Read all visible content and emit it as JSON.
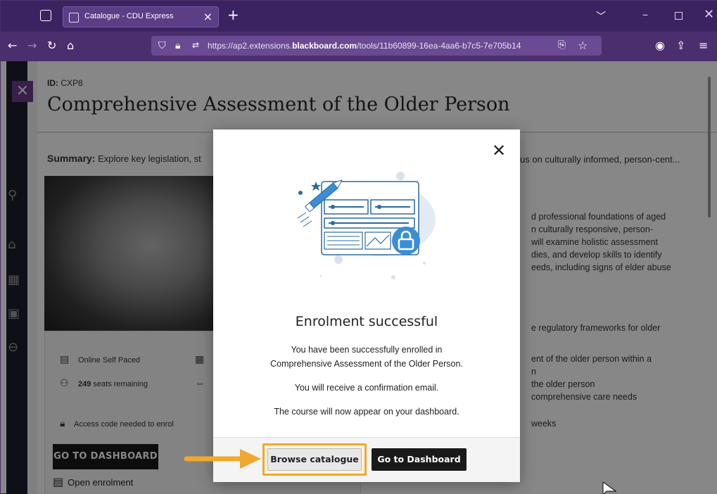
{
  "browser": {
    "tab_title": "Catalogue - CDU Express",
    "tab_close": "×",
    "new_tab": "+",
    "tabbar_chevron": "﹀",
    "window_min": "–",
    "window_close": "✕",
    "url_domain_prefix": "https://ap2.extensions.",
    "url_domain": "blackboard.com",
    "url_path": "/tools/11b60899-16ea-4aa6-b7c5-7e705b14"
  },
  "page": {
    "id_label": "ID:",
    "id_value": "CXP8",
    "course_title": "Comprehensive Assessment of the Older Person",
    "summary_label": "Summary:",
    "summary_text": "Explore key legislation, st",
    "summary_right": "us on culturally informed, person-cent...",
    "delivery": "Online Self Paced",
    "seats_count": "249",
    "seats_text": "seats remaining",
    "access_code": "Access code needed to enrol",
    "dashboard_button": "GO TO DASHBOARD",
    "open_enrolment": "Open enrolment",
    "right_lines": [
      "d professional foundations of aged",
      "n culturally responsive, person-",
      "will examine holistic assessment",
      "dies, and develop skills to identify",
      "eeds, including signs of elder abuse",
      "e regulatory frameworks for older",
      "ent of the older person within a",
      "n",
      "the older person",
      "comprehensive care needs",
      "weeks"
    ]
  },
  "modal": {
    "close": "✕",
    "title": "Enrolment successful",
    "line1": "You have been successfully enrolled in",
    "line2": "Comprehensive Assessment of the Older Person.",
    "line3": "You will receive a confirmation email.",
    "line4": "The course will now appear on your dashboard.",
    "browse_button": "Browse catalogue",
    "goto_button": "Go to Dashboard"
  },
  "colors": {
    "browser_chrome": "#3b2361",
    "highlight": "#f0a830",
    "primary_button": "#1a1a1a"
  }
}
